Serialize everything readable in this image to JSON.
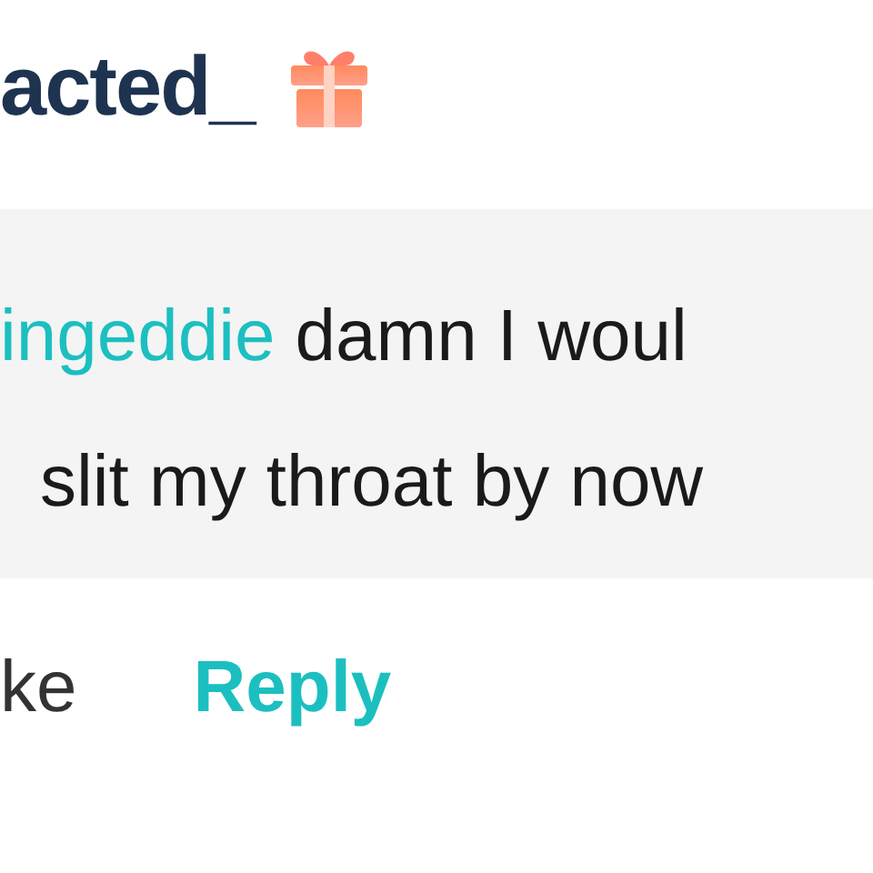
{
  "comment": {
    "author": "acted_",
    "mention": "ingeddie",
    "lines": [
      "damn I woul",
      "slit my throat by now"
    ]
  },
  "actions": [
    {
      "label": "ke",
      "kind": "like"
    },
    {
      "label": "Reply",
      "kind": "reply"
    }
  ]
}
